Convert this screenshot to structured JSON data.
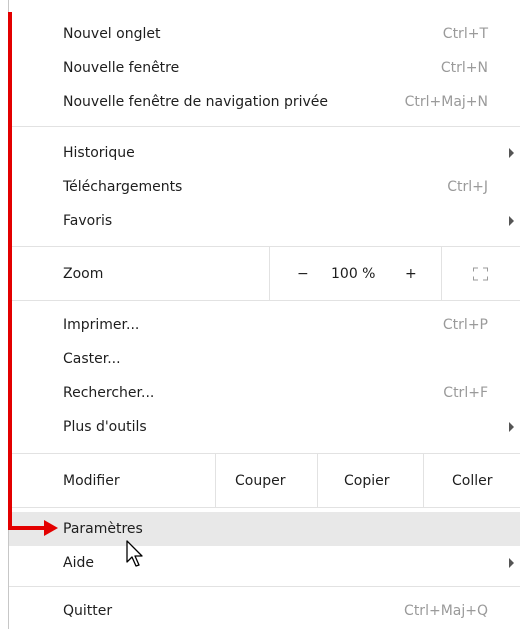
{
  "menu": {
    "new_tab": {
      "label": "Nouvel onglet",
      "shortcut": "Ctrl+T"
    },
    "new_window": {
      "label": "Nouvelle fenêtre",
      "shortcut": "Ctrl+N"
    },
    "new_incognito": {
      "label": "Nouvelle fenêtre de navigation privée",
      "shortcut": "Ctrl+Maj+N"
    },
    "history": {
      "label": "Historique"
    },
    "downloads": {
      "label": "Téléchargements",
      "shortcut": "Ctrl+J"
    },
    "bookmarks": {
      "label": "Favoris"
    },
    "zoom": {
      "label": "Zoom",
      "minus": "−",
      "value": "100 %",
      "plus": "+"
    },
    "print": {
      "label": "Imprimer...",
      "shortcut": "Ctrl+P"
    },
    "cast": {
      "label": "Caster..."
    },
    "find": {
      "label": "Rechercher...",
      "shortcut": "Ctrl+F"
    },
    "more_tools": {
      "label": "Plus d'outils"
    },
    "edit": {
      "label": "Modifier",
      "cut": "Couper",
      "copy": "Copier",
      "paste": "Coller"
    },
    "settings": {
      "label": "Paramètres"
    },
    "help": {
      "label": "Aide"
    },
    "quit": {
      "label": "Quitter",
      "shortcut": "Ctrl+Maj+Q"
    }
  },
  "colors": {
    "annotation_arrow": "#e30000",
    "hover_background": "#e8e8e8",
    "shortcut_text": "#9a9a9a"
  },
  "icons": {
    "submenu": "chevron-right-icon",
    "fullscreen": "fullscreen-icon",
    "cursor": "mouse-pointer-icon"
  }
}
